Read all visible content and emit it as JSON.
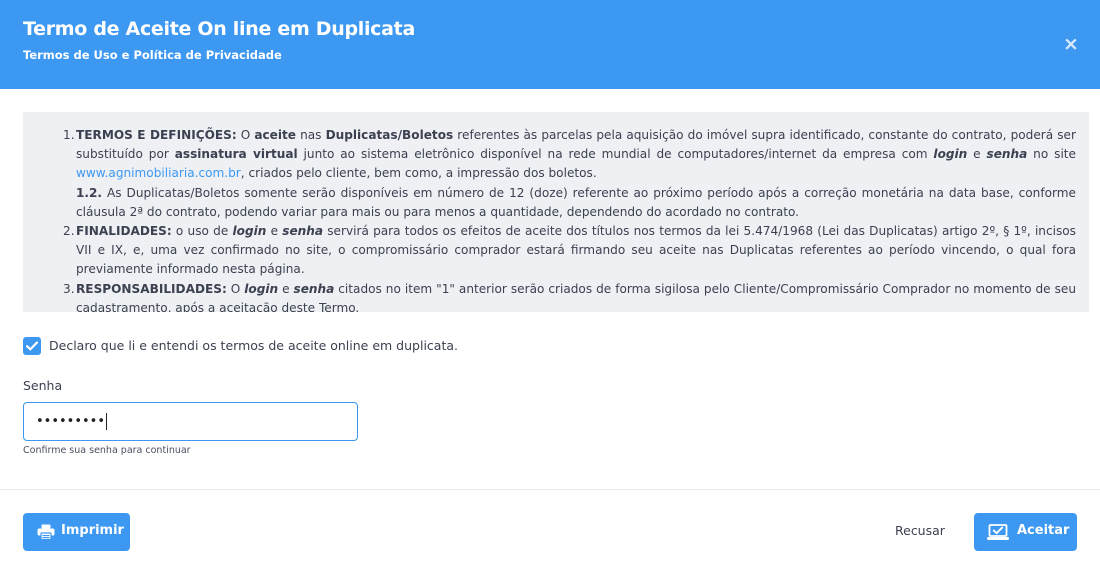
{
  "header": {
    "title": "Termo de Aceite On line em Duplicata",
    "subtitle": "Termos de Uso e Política de Privacidade",
    "close_symbol": "×",
    "bg_color": "#3d98f2"
  },
  "terms": {
    "items": [
      {
        "num": "1.",
        "heading": "TERMOS E DEFINIÇÕES:",
        "t1": " O ",
        "k1": "aceite",
        "t2": " nas ",
        "k2": "Duplicatas/Boletos",
        "t3": " referentes às parcelas pela aquisição do imóvel supra identificado, constante do contrato, poderá ser substituído por ",
        "k3": "assinatura virtual",
        "t4": " junto ao sistema eletrônico disponível na rede mundial de computadores/internet da empresa com ",
        "k4": "login",
        "t5": " e ",
        "k5": "senha",
        "t6": " no site ",
        "link": "www.agnimobiliaria.com.br",
        "t7": ", criados pelo cliente, bem como, a impressão dos boletos.",
        "sub_num": "1.2.",
        "sub_text": " As Duplicatas/Boletos somente serão disponíveis em número de 12 (doze) referente ao próximo período após a correção monetária na data base, conforme cláusula 2ª do contrato, podendo variar para mais ou para menos a quantidade, dependendo do acordado no contrato."
      },
      {
        "num": "2.",
        "heading": "FINALIDADES:",
        "t1": " o uso de ",
        "k1": "login",
        "t2": " e ",
        "k2": "senha",
        "t3": " servirá para todos os efeitos de aceite dos títulos nos termos da lei 5.474/1968 (Lei das Duplicatas) artigo 2º, § 1º, incisos VII e IX, e, uma vez confirmado no site, o compromissário comprador estará firmando seu aceite nas Duplicatas referentes ao período vincendo, o qual fora previamente informado nesta página."
      },
      {
        "num": "3.",
        "heading": "RESPONSABILIDADES:",
        "t1": " O ",
        "k1": "login",
        "t2": " e ",
        "k2": "senha",
        "t3": " citados no item \"1\" anterior serão criados de forma sigilosa pelo Cliente/Compromissário Comprador no momento de seu cadastramento, após a aceitação deste Termo."
      }
    ]
  },
  "agreement": {
    "checked": true,
    "label": "Declaro que li e entendi os termos de aceite online em duplicata."
  },
  "password": {
    "label": "Senha",
    "value": "•••••••••",
    "help": "Confirme sua senha para continuar"
  },
  "footer": {
    "print_label": "Imprimir",
    "print_icon": "printer-icon",
    "refuse_label": "Recusar",
    "accept_label": "Aceitar",
    "accept_icon": "laptop-check-icon",
    "accent_color": "#3d98f2"
  }
}
